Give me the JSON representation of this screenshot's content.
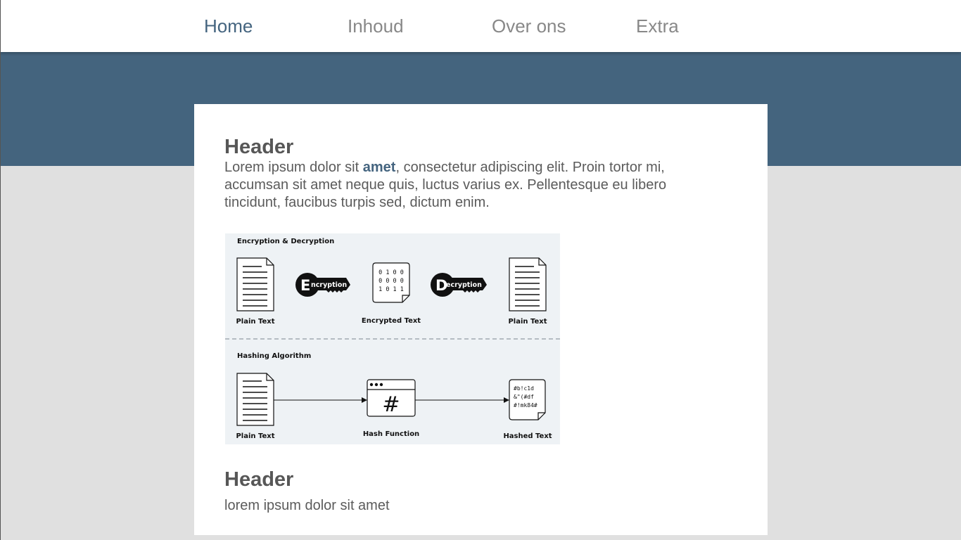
{
  "nav": {
    "items": [
      {
        "label": "Home",
        "active": true
      },
      {
        "label": "Inhoud",
        "active": false
      },
      {
        "label": "Over ons",
        "active": false
      },
      {
        "label": "Extra",
        "active": false
      }
    ]
  },
  "colors": {
    "accent": "#44647f",
    "band": "#44647e",
    "page_bg": "#e0e0e0",
    "text": "#5b5b5b",
    "figure_bg": "#eef2f5"
  },
  "section1": {
    "title": "Header",
    "text_before": "Lorem ipsum dolor sit ",
    "text_emphasis": "amet",
    "text_after": ", consectetur adipiscing elit. Proin tortor mi, accumsan sit amet neque quis, luctus varius ex. Pellentesque eu libero tincidunt, faucibus turpis sed, dictum enim."
  },
  "figure": {
    "top_title": "Encryption & Decryption",
    "key1_letter": "E",
    "key1_text": "ncryption",
    "key2_letter": "D",
    "key2_text": "ecryption",
    "binary_rows": [
      "0 1 0 0",
      "0 0 0 0",
      "1 0 1 1"
    ],
    "plain_text_label": "Plain Text",
    "encrypted_label": "Encrypted Text",
    "bottom_title": "Hashing Algorithm",
    "hash_symbol": "#",
    "hash_function_label": "Hash Function",
    "hashed_rows": [
      "#b!c1d",
      "&\"(#df",
      "#!mk84#"
    ],
    "hashed_label": "Hashed Text"
  },
  "section2": {
    "title": "Header",
    "text": "lorem ipsum dolor sit amet"
  }
}
